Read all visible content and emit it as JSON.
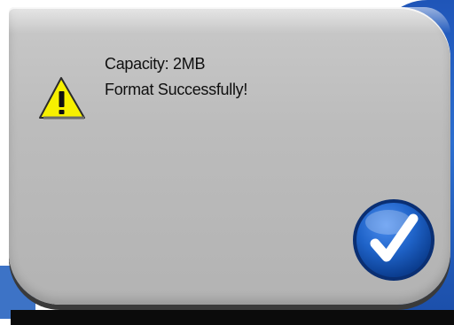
{
  "dialog": {
    "icon": "warning-icon",
    "lines": [
      "Capacity: 2MB",
      "Format Successfully!"
    ],
    "confirm_button": {
      "icon": "checkmark-icon"
    }
  },
  "colors": {
    "dialog_bg": "#bdbdbd",
    "warning_yellow": "#f7f000",
    "button_blue": "#1f63c8",
    "background_blue": "#2d6fd0"
  }
}
